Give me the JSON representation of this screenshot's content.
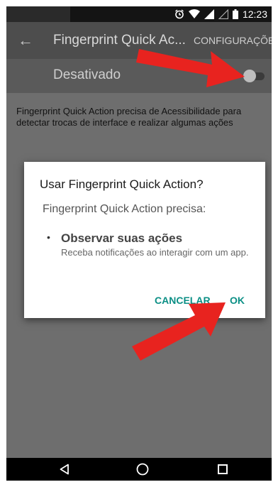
{
  "status_bar": {
    "time": "12:23",
    "icons": [
      "alarm-icon",
      "wifi-icon",
      "signal-icon",
      "signal-empty-icon",
      "battery-icon"
    ]
  },
  "toolbar": {
    "back_icon": "arrow-left-icon",
    "title": "Fingerprint Quick Ac...",
    "action_label": "CONFIGURAÇÕES"
  },
  "switch_bar": {
    "label": "Desativado",
    "switch_on": false
  },
  "description": "Fingerprint Quick Action precisa de Acessibilidade para detectar trocas de interface e realizar algumas ações",
  "dialog": {
    "title": "Usar Fingerprint Quick Action?",
    "subtitle": "Fingerprint Quick Action precisa:",
    "permission": {
      "title": "Observar suas ações",
      "description": "Receba notificações ao interagir com um app."
    },
    "cancel_label": "CANCELAR",
    "ok_label": "OK"
  },
  "nav_bar": {
    "icons": [
      "back-triangle-icon",
      "home-circle-icon",
      "recents-square-icon"
    ]
  },
  "colors": {
    "accent": "#0b8f85",
    "annotation_arrow": "#e8231f"
  }
}
